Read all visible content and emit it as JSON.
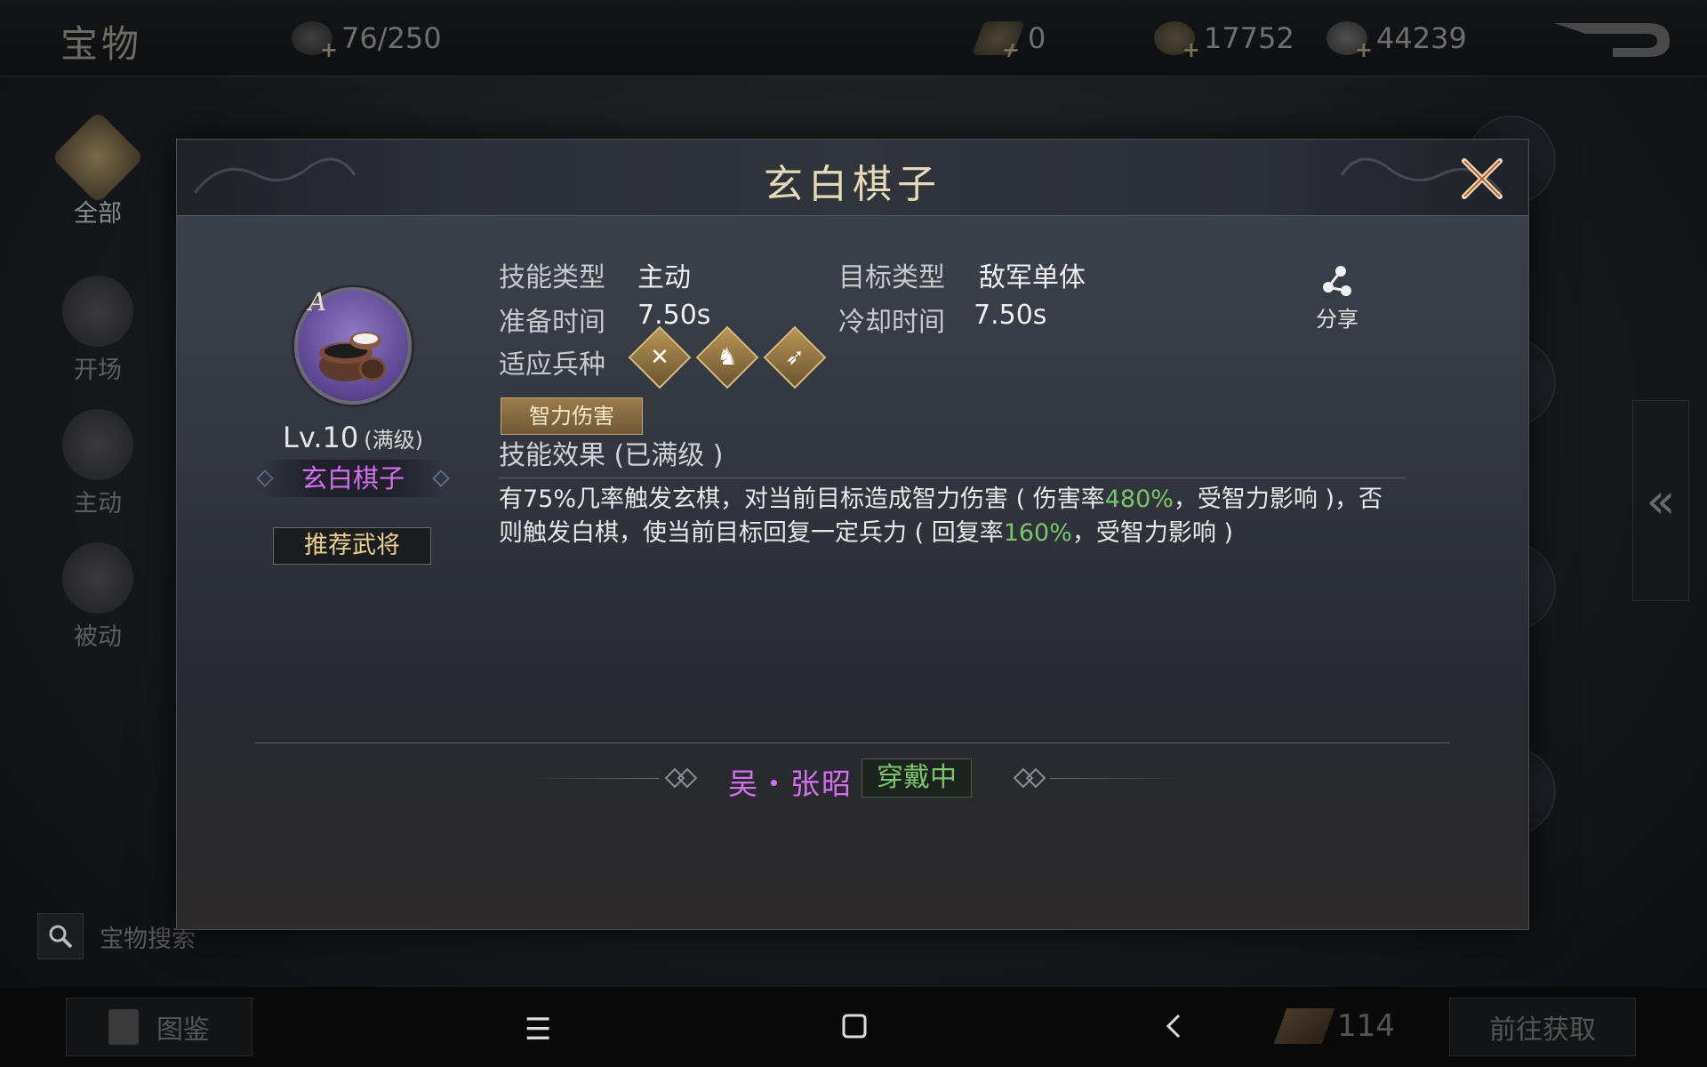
{
  "topbar": {
    "title": "宝物",
    "capacity": "76/250",
    "resources": [
      {
        "icon": "ingot-icon",
        "value": "0"
      },
      {
        "icon": "copper-coin-icon",
        "value": "17752"
      },
      {
        "icon": "silver-coin-icon",
        "value": "44239"
      }
    ]
  },
  "sidenav": {
    "items": [
      {
        "label": "全部",
        "icon": "all-icon",
        "active": true
      },
      {
        "label": "开场",
        "icon": "opening-icon"
      },
      {
        "label": "主动",
        "icon": "active-skill-icon"
      },
      {
        "label": "被动",
        "icon": "passive-skill-icon"
      }
    ]
  },
  "search": {
    "label": "宝物搜索"
  },
  "bottom": {
    "atlas_label": "图鉴",
    "count": "114",
    "goto_label": "前往获取"
  },
  "modal": {
    "title": "玄白棋子",
    "item": {
      "grade": "A",
      "level": "Lv.10",
      "level_note": "(满级)",
      "name": "玄白棋子",
      "recommend_label": "推荐武将"
    },
    "info": {
      "skill_type_label": "技能类型",
      "skill_type_value": "主动",
      "target_type_label": "目标类型",
      "target_type_value": "敌军单体",
      "prep_label": "准备时间",
      "prep_value": "7.50s",
      "cooldown_label": "冷却时间",
      "cooldown_value": "7.50s",
      "troop_label": "适应兵种",
      "troop_icons": [
        "infantry-icon",
        "cavalry-icon",
        "archer-icon"
      ],
      "damage_tag": "智力伤害",
      "effect_title": "技能效果 (已满级 )",
      "effect_parts": {
        "p1": "有75%几率触发玄棋，对当前目标造成智力伤害 ( 伤害率",
        "h1": "480%",
        "p2": "，受智力影响 )，否则触发白棋，使当前目标回复一定兵力 ( 回复率",
        "h2": "160%",
        "p3": "，受智力影响 )"
      }
    },
    "share_label": "分享",
    "wearer": {
      "name": "吴・张昭",
      "status": "穿戴中"
    }
  },
  "colors": {
    "accent_gold": "#e6d9b8",
    "name_purple": "#d46ff0",
    "highlight_green": "#7cc46a"
  }
}
